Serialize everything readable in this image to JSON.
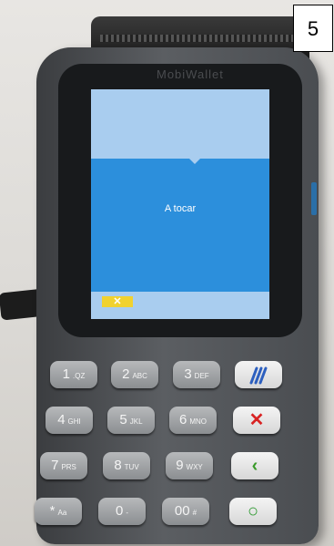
{
  "corner_label": "5",
  "device": {
    "brand": "MobiWallet",
    "screen_message": "A tocar",
    "cancel_glyph": "✕",
    "keys": [
      {
        "main": "1",
        "sub": ".QZ"
      },
      {
        "main": "2",
        "sub": "ABC"
      },
      {
        "main": "3",
        "sub": "DEF"
      },
      {
        "main": "4",
        "sub": "GHI"
      },
      {
        "main": "5",
        "sub": "JKL"
      },
      {
        "main": "6",
        "sub": "MNO"
      },
      {
        "main": "7",
        "sub": "PRS"
      },
      {
        "main": "8",
        "sub": "TUV"
      },
      {
        "main": "9",
        "sub": "WXY"
      },
      {
        "main": "*",
        "sub": "Aa"
      },
      {
        "main": "0",
        "sub": "-"
      },
      {
        "main": "00",
        "sub": "#"
      }
    ],
    "function_keys": {
      "contactless": "contactless-icon",
      "cancel": "✕",
      "cancel_color": "#d82222",
      "clear": "‹",
      "clear_color": "#3a9a2a",
      "enter": "○",
      "enter_color": "#2e9a30"
    }
  }
}
